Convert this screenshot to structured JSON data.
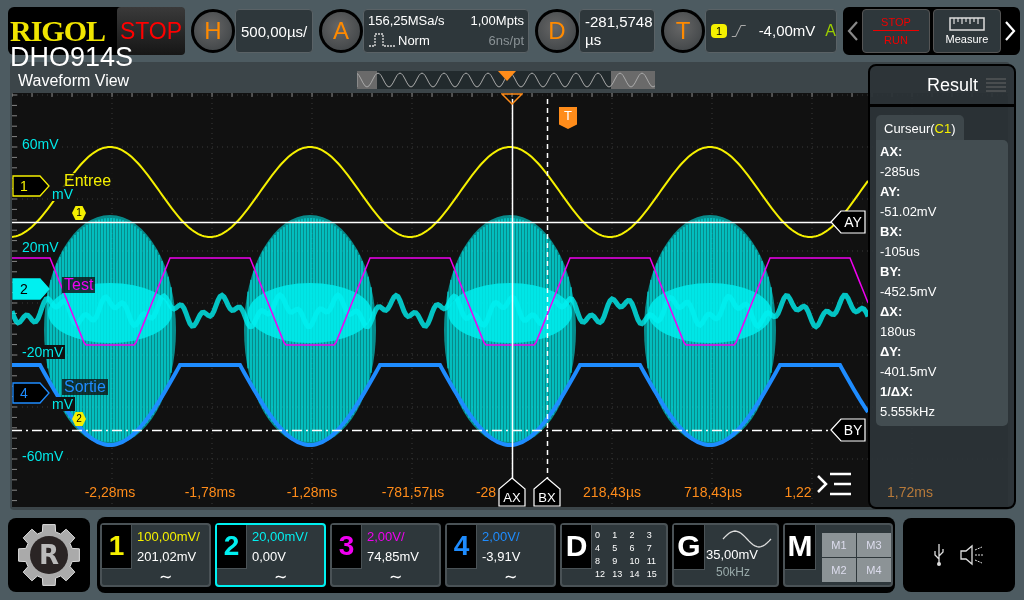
{
  "top_bar": {
    "brand": "RIGOL",
    "run_state": "STOP",
    "model": "DHO914S",
    "horizontal": {
      "letter": "H",
      "scale": "500,00µs/"
    },
    "acquisition": {
      "letter": "A",
      "sample_rate": "156,25MSa/s",
      "memory_depth": "1,00Mpts",
      "mode": "Norm",
      "resolution": "6ns/pt"
    },
    "delay": {
      "letter": "D",
      "value": "-281,5748",
      "unit": "µs"
    },
    "trigger": {
      "letter": "T",
      "source": "1",
      "level": "-4,00mV",
      "status": "A"
    },
    "quick_buttons": [
      {
        "kind": "run_stop",
        "top": "STOP",
        "bottom": "RUN"
      },
      {
        "kind": "measure",
        "label": "Measure"
      }
    ]
  },
  "waveform_view": {
    "title": "Waveform View",
    "y_labels": [
      "60mV",
      "mV",
      "20mV",
      "-20mV",
      "mV",
      "-60mV"
    ],
    "x_labels": [
      "-2,28ms",
      "-1,78ms",
      "-1,28ms",
      "-781,57µs",
      "-28",
      "218,43µs",
      "718,43µs",
      "1,22",
      "1,72ms"
    ],
    "traces": [
      {
        "kind": "sine",
        "label": "Entree"
      },
      {
        "kind": "burst"
      },
      {
        "kind": "trapezoid",
        "label": "Test"
      },
      {
        "kind": "rounded",
        "label": "Sortie"
      }
    ],
    "channel_markers": [
      {
        "label": "1",
        "selected": false
      },
      {
        "label": "2",
        "selected": true
      },
      {
        "label": "4",
        "selected": false
      }
    ],
    "cursor_tags": [
      "1",
      "2"
    ],
    "cursors": [
      {
        "label": "AX",
        "kind": "vertical"
      },
      {
        "label": "BX",
        "kind": "vertical"
      },
      {
        "label": "AY",
        "kind": "horizontal"
      },
      {
        "label": "BY",
        "kind": "horizontal"
      }
    ],
    "trigger_tag": "T"
  },
  "result_panel": {
    "title": "Result",
    "tab": {
      "prefix": "Curseur(",
      "source": "C1",
      "suffix": ")"
    },
    "readings": [
      {
        "label": "AX:",
        "value": "-285us"
      },
      {
        "label": "AY:",
        "value": "-51.02mV"
      },
      {
        "label": "BX:",
        "value": "-105us"
      },
      {
        "label": "BY:",
        "value": "-452.5mV"
      },
      {
        "label": "ΔX:",
        "value": "180us"
      },
      {
        "label": "ΔY:",
        "value": "-401.5mV"
      },
      {
        "label": "1/ΔX:",
        "value": "5.555kHz"
      }
    ]
  },
  "channel_bar": {
    "logo": "R",
    "channels": [
      {
        "number": "1",
        "scale": "100,00mV/",
        "offset": "201,02mV",
        "coupling": "∼",
        "color": "#f5f000",
        "selected": false
      },
      {
        "number": "2",
        "scale": "20,00mV/",
        "offset": "0,00V",
        "coupling": "∼",
        "color": "#00f0f0",
        "selected": true
      },
      {
        "number": "3",
        "scale": "2,00V/",
        "offset": "74,85mV",
        "coupling": "∼",
        "color": "#f000f0",
        "selected": false
      },
      {
        "number": "4",
        "scale": "2,00V/",
        "offset": "-3,91V",
        "coupling": "∼",
        "color": "#1e8cff",
        "selected": false
      }
    ],
    "digital": {
      "letter": "D",
      "bits": [
        "0",
        "1",
        "2",
        "3",
        "4",
        "5",
        "6",
        "7",
        "8",
        "9",
        "10",
        "11",
        "12",
        "13",
        "14",
        "15"
      ]
    },
    "generator": {
      "letter": "G",
      "amplitude": "35,00mV",
      "frequency": "50kHz"
    },
    "math": {
      "letter": "M",
      "items": [
        "M1",
        "M3",
        "M2",
        "M4"
      ]
    }
  }
}
